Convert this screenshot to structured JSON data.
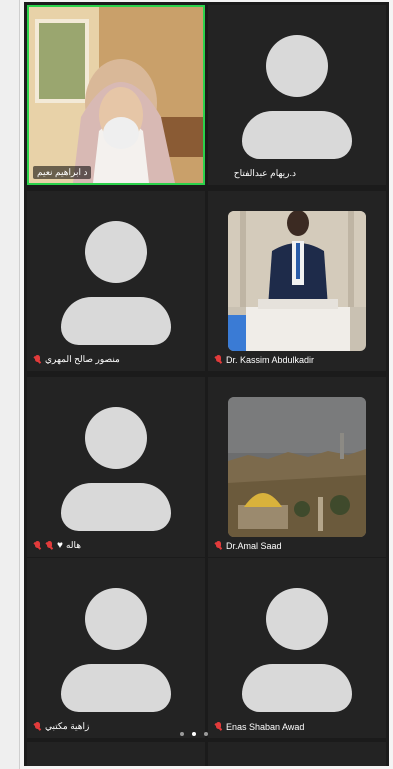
{
  "participants": [
    {
      "name": "د ابراهيم نعيم",
      "muted": false,
      "video": "man-in-headdress",
      "active": true
    },
    {
      "name": "د.ريهام عبدالفتاح",
      "muted": false,
      "video": null
    },
    {
      "name": "منصور صالح المهري",
      "muted": true,
      "video": null
    },
    {
      "name": "Dr. Kassim Abdulkadir",
      "muted": true,
      "video": "speaker-at-podium"
    },
    {
      "name": "هاله",
      "muted": true,
      "video": null,
      "reaction": "heart"
    },
    {
      "name": "Dr.Amal Saad",
      "muted": true,
      "video": "city-mosque-view"
    },
    {
      "name": "زاهية مكتبي",
      "muted": true,
      "video": null
    },
    {
      "name": "Enas Shaban Awad",
      "muted": true,
      "video": null
    }
  ],
  "pagination": {
    "pages": 3,
    "current": 2
  },
  "colors": {
    "active_border": "#2bd24b",
    "muted_icon": "#e23b3b",
    "tile_bg": "#232323"
  }
}
